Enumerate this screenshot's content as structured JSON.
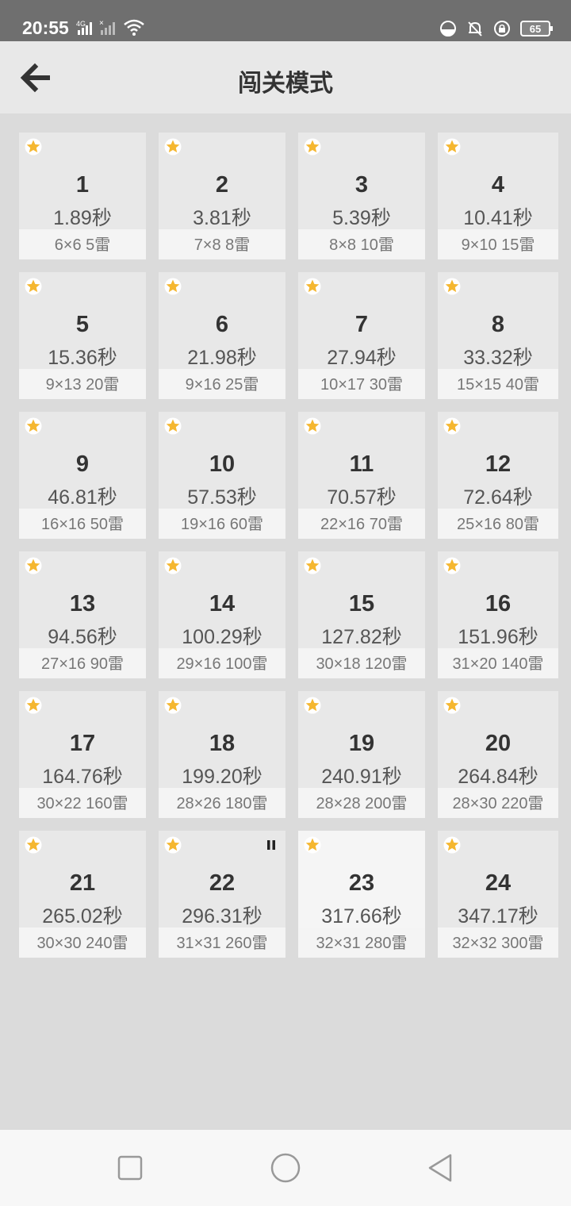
{
  "status": {
    "time": "20:55",
    "network": "4G",
    "battery": "65"
  },
  "header": {
    "title": "闯关模式"
  },
  "levels": [
    {
      "num": "1",
      "time": "1.89秒",
      "info": "6×6  5雷"
    },
    {
      "num": "2",
      "time": "3.81秒",
      "info": "7×8  8雷"
    },
    {
      "num": "3",
      "time": "5.39秒",
      "info": "8×8  10雷"
    },
    {
      "num": "4",
      "time": "10.41秒",
      "info": "9×10  15雷"
    },
    {
      "num": "5",
      "time": "15.36秒",
      "info": "9×13  20雷"
    },
    {
      "num": "6",
      "time": "21.98秒",
      "info": "9×16  25雷"
    },
    {
      "num": "7",
      "time": "27.94秒",
      "info": "10×17  30雷"
    },
    {
      "num": "8",
      "time": "33.32秒",
      "info": "15×15  40雷"
    },
    {
      "num": "9",
      "time": "46.81秒",
      "info": "16×16  50雷"
    },
    {
      "num": "10",
      "time": "57.53秒",
      "info": "19×16  60雷"
    },
    {
      "num": "11",
      "time": "70.57秒",
      "info": "22×16  70雷"
    },
    {
      "num": "12",
      "time": "72.64秒",
      "info": "25×16  80雷"
    },
    {
      "num": "13",
      "time": "94.56秒",
      "info": "27×16  90雷"
    },
    {
      "num": "14",
      "time": "100.29秒",
      "info": "29×16  100雷"
    },
    {
      "num": "15",
      "time": "127.82秒",
      "info": "30×18  120雷"
    },
    {
      "num": "16",
      "time": "151.96秒",
      "info": "31×20  140雷"
    },
    {
      "num": "17",
      "time": "164.76秒",
      "info": "30×22  160雷"
    },
    {
      "num": "18",
      "time": "199.20秒",
      "info": "28×26  180雷"
    },
    {
      "num": "19",
      "time": "240.91秒",
      "info": "28×28  200雷"
    },
    {
      "num": "20",
      "time": "264.84秒",
      "info": "28×30  220雷"
    },
    {
      "num": "21",
      "time": "265.02秒",
      "info": "30×30  240雷"
    },
    {
      "num": "22",
      "time": "296.31秒",
      "info": "31×31  260雷",
      "paused": true
    },
    {
      "num": "23",
      "time": "317.66秒",
      "info": "32×31  280雷",
      "active": true
    },
    {
      "num": "24",
      "time": "347.17秒",
      "info": "32×32  300雷"
    }
  ],
  "colors": {
    "star": "#f5b730",
    "tile": "#e8e8e8",
    "tile_active": "#f5f5f5"
  },
  "icons": {
    "back": "arrow-left-icon",
    "star": "star-icon",
    "pause": "pause-icon"
  }
}
